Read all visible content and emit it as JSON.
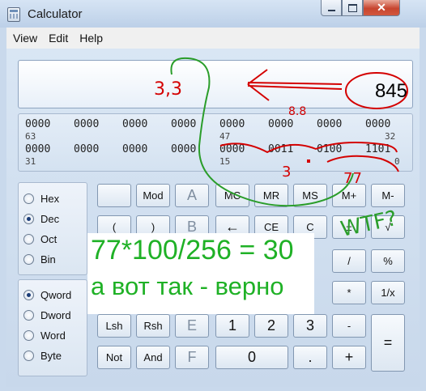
{
  "window": {
    "title": "Calculator"
  },
  "menu": {
    "items": [
      "View",
      "Edit",
      "Help"
    ]
  },
  "display": {
    "value": "845"
  },
  "bits": {
    "row1": [
      "0000",
      "0000",
      "0000",
      "0000",
      "0000",
      "0000",
      "0000",
      "0000"
    ],
    "row1_indices": [
      "63",
      "47",
      "32"
    ],
    "row2": [
      "0000",
      "0000",
      "0000",
      "0000",
      "0000",
      "0011",
      "0100",
      "1101"
    ],
    "row2_indices": [
      "31",
      "15",
      "0"
    ]
  },
  "base_options": [
    {
      "label": "Hex",
      "selected": false
    },
    {
      "label": "Dec",
      "selected": true
    },
    {
      "label": "Oct",
      "selected": false
    },
    {
      "label": "Bin",
      "selected": false
    }
  ],
  "word_options": [
    {
      "label": "Qword",
      "selected": true
    },
    {
      "label": "Dword",
      "selected": false
    },
    {
      "label": "Word",
      "selected": false
    },
    {
      "label": "Byte",
      "selected": false
    }
  ],
  "keys": {
    "row1": [
      "",
      "Mod",
      "A",
      "MC",
      "MR",
      "MS",
      "M+",
      "M-"
    ],
    "row2": [
      "(",
      ")",
      "B",
      "←",
      "CE",
      "C",
      "±",
      "√"
    ],
    "row3": [
      "/",
      "%"
    ],
    "row4": [
      "*",
      "1/x"
    ],
    "row5": [
      "Lsh",
      "Rsh",
      "E",
      "1",
      "2",
      "3",
      "-",
      "="
    ],
    "row6": [
      "Not",
      "And",
      "F",
      "0",
      ".",
      "+"
    ]
  },
  "annotation": {
    "line1": "77*100/256 = 30",
    "line2": "а вот так - верно"
  },
  "handwriting": {
    "left_note": "3,3",
    "mid_note": "8.8",
    "low_note": "3",
    "right_note": "77",
    "wtf": "WTF?"
  },
  "colors": {
    "annotation_green": "#1fb126",
    "handwriting_red": "#d40000",
    "handwriting_green": "#2a9d2a"
  }
}
